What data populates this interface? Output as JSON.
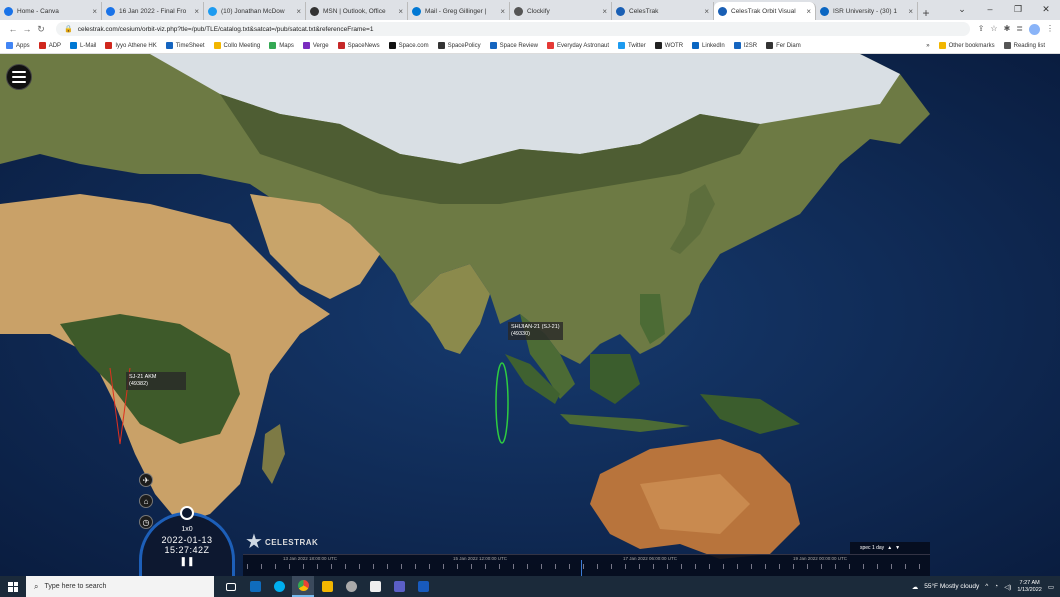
{
  "browser": {
    "tabs": [
      {
        "title": "Home - Canva",
        "color": "#1a73e8",
        "active": false
      },
      {
        "title": "16 Jan 2022 - Final Fro",
        "color": "#1a73e8",
        "active": false
      },
      {
        "title": "(10) Jonathan McDow",
        "color": "#1d9bf0",
        "active": false
      },
      {
        "title": "MSN | Outlook, Office",
        "color": "#333333",
        "active": false
      },
      {
        "title": "Mail - Greg Gillinger |",
        "color": "#0078d4",
        "active": false
      },
      {
        "title": "Clockify",
        "color": "#555555",
        "active": false
      },
      {
        "title": "CelesTrak",
        "color": "#1a5fb4",
        "active": false
      },
      {
        "title": "CelesTrak Orbit Visual",
        "color": "#1a5fb4",
        "active": true
      },
      {
        "title": "ISR University - (30) 1",
        "color": "#0a66c2",
        "active": false
      }
    ],
    "url": "celestrak.com/cesium/orbit-viz.php?tle=/pub/TLE/catalog.txt&satcat=/pub/satcat.txt&referenceFrame=1",
    "bookmarks": [
      {
        "label": "Apps",
        "color": "#4285f4"
      },
      {
        "label": "ADP",
        "color": "#d0271d"
      },
      {
        "label": "L-Mail",
        "color": "#0078d4"
      },
      {
        "label": "Iyyo Athene HK",
        "color": "#d0271d"
      },
      {
        "label": "TimeSheet",
        "color": "#1565c0"
      },
      {
        "label": "Collo Meeting",
        "color": "#f2b600"
      },
      {
        "label": "Maps",
        "color": "#34a853"
      },
      {
        "label": "Verge",
        "color": "#7b2cbf"
      },
      {
        "label": "SpaceNews",
        "color": "#c62828"
      },
      {
        "label": "Space.com",
        "color": "#111111"
      },
      {
        "label": "SpacePolicy",
        "color": "#333333"
      },
      {
        "label": "Space Review",
        "color": "#1565c0"
      },
      {
        "label": "Everyday Astronaut",
        "color": "#e53935"
      },
      {
        "label": "Twitter",
        "color": "#1d9bf0"
      },
      {
        "label": "WOTR",
        "color": "#222222"
      },
      {
        "label": "LinkedIn",
        "color": "#0a66c2"
      },
      {
        "label": "I2SR",
        "color": "#1565c0"
      },
      {
        "label": "Fer Diam",
        "color": "#333333"
      }
    ],
    "other_bookmarks": "Other bookmarks",
    "reading_list": "Reading list"
  },
  "viewer": {
    "satellites": [
      {
        "name": "SHIJIAN-21 (SJ-21)",
        "id": "(49330)",
        "color": "#2ecc40"
      },
      {
        "name": "SJ-21 AKM",
        "id": "(49382)",
        "color": "#e0301e"
      }
    ],
    "clock": {
      "speed": "1x0",
      "date": "2022-01-13",
      "time": "15:27:42Z",
      "pause_icon": "pause-icon"
    },
    "logo": "CELESTRAK",
    "timeline_labels": [
      "13 Jan 2022 18:00:00 UTC",
      "15 Jan 2022 12:00:00 UTC",
      "17 Jan 2022 06:00:00 UTC",
      "19 Jan 2022 00:00:00 UTC"
    ],
    "speed_control": "spec 1 day"
  },
  "taskbar": {
    "search_placeholder": "Type here to search",
    "weather": "55°F  Mostly cloudy",
    "time": "7:27 AM",
    "date": "1/13/2022"
  }
}
